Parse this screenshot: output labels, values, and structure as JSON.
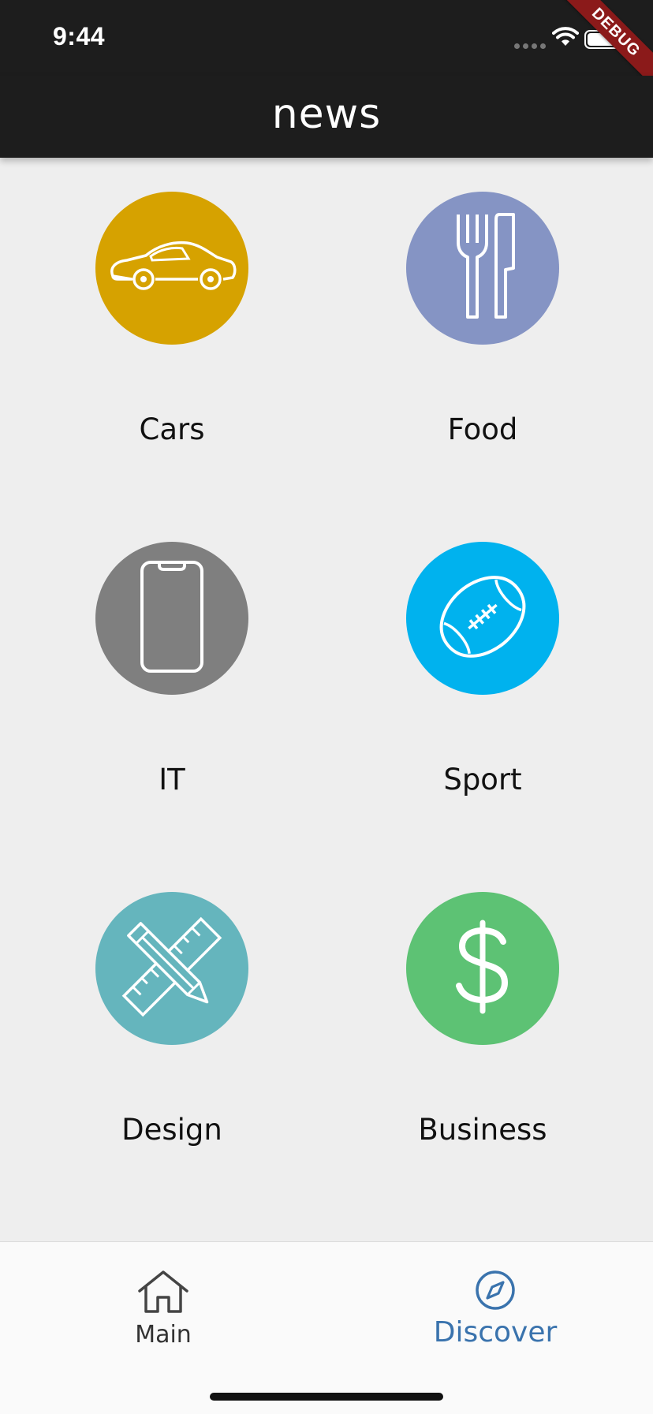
{
  "status_bar": {
    "time": "9:44",
    "icons": [
      "cellular-signal-icon",
      "wifi-icon",
      "battery-icon"
    ],
    "debug_banner": "DEBUG"
  },
  "app_bar": {
    "title": "news"
  },
  "categories": [
    {
      "label": "Cars",
      "icon": "car-icon",
      "color": "#d6a200"
    },
    {
      "label": "Food",
      "icon": "fork-knife-icon",
      "color": "#8594c4"
    },
    {
      "label": "IT",
      "icon": "smartphone-icon",
      "color": "#7f7f7f"
    },
    {
      "label": "Sport",
      "icon": "football-icon",
      "color": "#00b2ee"
    },
    {
      "label": "Design",
      "icon": "ruler-pencil-icon",
      "color": "#65b5bd"
    },
    {
      "label": "Business",
      "icon": "dollar-icon",
      "color": "#5dc274"
    }
  ],
  "bottom_nav": {
    "items": [
      {
        "label": "Main",
        "icon": "home-icon",
        "active": false
      },
      {
        "label": "Discover",
        "icon": "compass-icon",
        "active": true
      }
    ],
    "active_color": "#3a73ad",
    "inactive_color": "#333333"
  }
}
